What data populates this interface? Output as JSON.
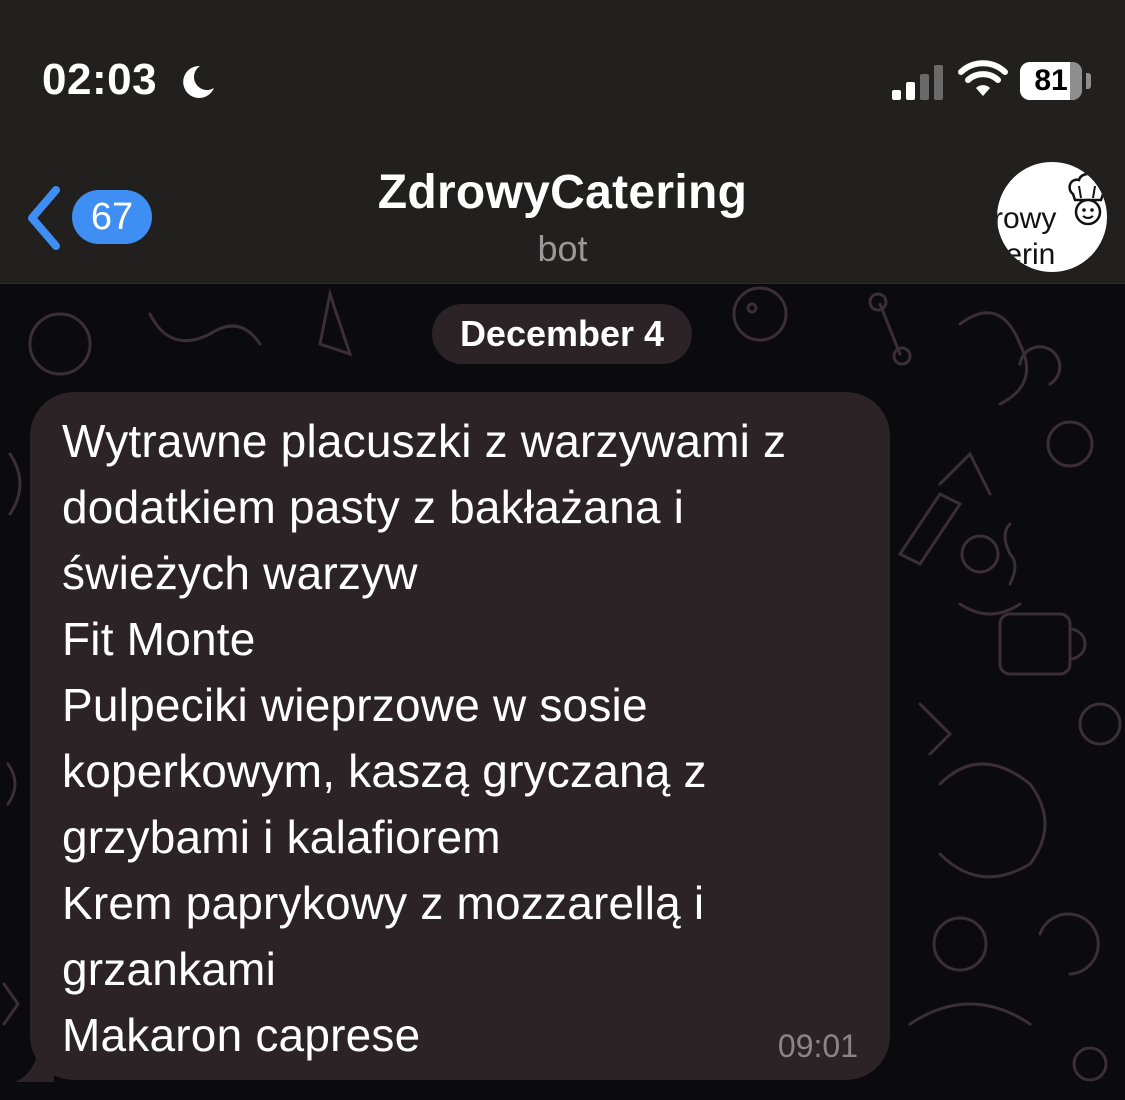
{
  "status_bar": {
    "time": "02:03",
    "battery": "81",
    "battery_fraction": 0.81,
    "icons": [
      "moon-icon",
      "cellular-signal-icon",
      "wifi-icon",
      "battery-icon"
    ]
  },
  "nav": {
    "back_icon": "chevron-left-icon",
    "unread_count": "67",
    "title": "ZdrowyCatering",
    "subtitle": "bot",
    "avatar_text_line1": "rowy",
    "avatar_text_line2": "terin",
    "avatar_icon": "chef-icon"
  },
  "chat": {
    "date_separator": "December 4",
    "messages": [
      {
        "lines": [
          "Wytrawne placuszki z warzywami z",
          "dodatkiem pasty z bakłażana i",
          "świeżych warzyw",
          "Fit Monte",
          "Pulpeciki wieprzowe w sosie",
          "koperkowym, kaszą gryczaną z",
          "grzybami i kalafiorem",
          "Krem paprykowy z mozzarellą i",
          "grzankami",
          "Makaron caprese"
        ],
        "time": "09:01"
      }
    ]
  },
  "colors": {
    "header_bg": "#221f1f",
    "bubble_bg": "#2c2327",
    "accent_blue": "#3f8ef3",
    "chat_bg": "#0b0a0c"
  }
}
